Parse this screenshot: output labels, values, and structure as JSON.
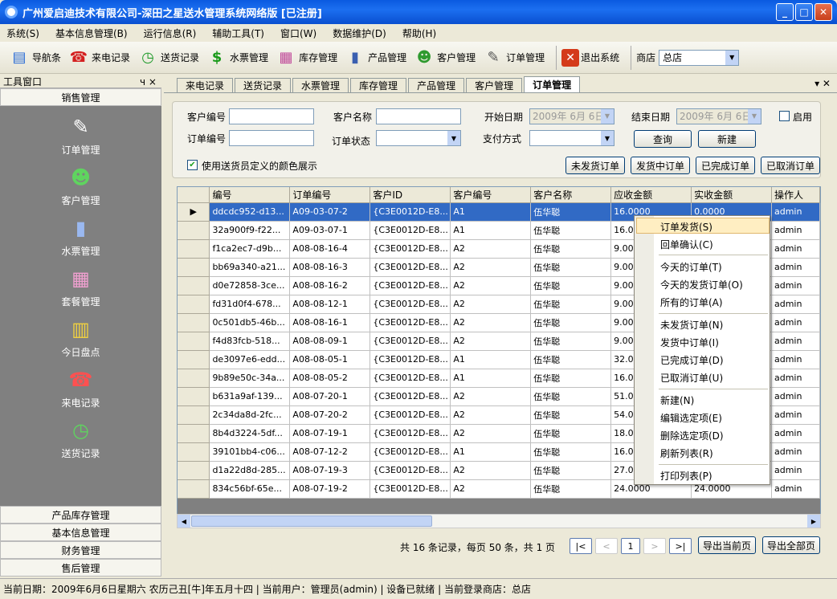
{
  "window": {
    "title": "广州爱启迪技术有限公司-深田之星送水管理系统网络版 [已注册]"
  },
  "menu": [
    "系统(S)",
    "基本信息管理(B)",
    "运行信息(R)",
    "辅助工具(T)",
    "窗口(W)",
    "数据维护(D)",
    "帮助(H)"
  ],
  "toolbar": {
    "items": [
      {
        "label": "导航条",
        "icon": "navigation-icon"
      },
      {
        "label": "来电记录",
        "icon": "phone-icon"
      },
      {
        "label": "送货记录",
        "icon": "clock-icon"
      },
      {
        "label": "水票管理",
        "icon": "dollar-icon"
      },
      {
        "label": "库存管理",
        "icon": "inventory-icon"
      },
      {
        "label": "产品管理",
        "icon": "product-icon"
      },
      {
        "label": "客户管理",
        "icon": "customers-icon"
      },
      {
        "label": "订单管理",
        "icon": "order-icon"
      },
      {
        "label": "退出系统",
        "icon": "exit-icon"
      }
    ],
    "shop_label": "商店",
    "shop_value": "总店"
  },
  "left": {
    "header": "工具窗口",
    "pin": "ч ×",
    "group_top": "销售管理",
    "items": [
      "订单管理",
      "客户管理",
      "水票管理",
      "套餐管理",
      "今日盘点",
      "来电记录",
      "送货记录"
    ],
    "groups_bottom": [
      "产品库存管理",
      "基本信息管理",
      "财务管理",
      "售后管理"
    ]
  },
  "tabs": [
    "来电记录",
    "送货记录",
    "水票管理",
    "库存管理",
    "产品管理",
    "客户管理",
    "订单管理"
  ],
  "filter": {
    "cust_no": "客户编号",
    "cust_name": "客户名称",
    "start_date": "开始日期",
    "start_value": "2009年 6月 6日",
    "end_date": "结束日期",
    "end_value": "2009年 6月 6日",
    "enable": "启用",
    "order_no": "订单编号",
    "order_status": "订单状态",
    "pay_method": "支付方式",
    "query": "查询",
    "new": "新建",
    "use_color": "使用送货员定义的颜色展示",
    "btn_unsent": "未发货订单",
    "btn_sending": "发货中订单",
    "btn_done": "已完成订单",
    "btn_cancel": "已取消订单"
  },
  "grid": {
    "columns": [
      "编号",
      "订单编号",
      "客户ID",
      "客户编号",
      "客户名称",
      "应收金额",
      "实收金额",
      "操作人"
    ],
    "rows": [
      [
        "ddcdc952-d13...",
        "A09-03-07-2",
        "{C3E0012D-E8...",
        "A1",
        "伍华聪",
        "16.0000",
        "0.0000",
        "admin"
      ],
      [
        "32a900f9-f22...",
        "A09-03-07-1",
        "{C3E0012D-E8...",
        "A1",
        "伍华聪",
        "16.0",
        "",
        "admin"
      ],
      [
        "f1ca2ec7-d9b...",
        "A08-08-16-4",
        "{C3E0012D-E8...",
        "A2",
        "伍华聪",
        "9.00",
        "",
        "admin"
      ],
      [
        "bb69a340-a21...",
        "A08-08-16-3",
        "{C3E0012D-E8...",
        "A2",
        "伍华聪",
        "9.00",
        "",
        "admin"
      ],
      [
        "d0e72858-3ce...",
        "A08-08-16-2",
        "{C3E0012D-E8...",
        "A2",
        "伍华聪",
        "9.00",
        "",
        "admin"
      ],
      [
        "fd31d0f4-678...",
        "A08-08-12-1",
        "{C3E0012D-E8...",
        "A2",
        "伍华聪",
        "9.00",
        "",
        "admin"
      ],
      [
        "0c501db5-46b...",
        "A08-08-16-1",
        "{C3E0012D-E8...",
        "A2",
        "伍华聪",
        "9.00",
        "",
        "admin"
      ],
      [
        "f4d83fcb-518...",
        "A08-08-09-1",
        "{C3E0012D-E8...",
        "A2",
        "伍华聪",
        "9.00",
        "",
        "admin"
      ],
      [
        "de3097e6-edd...",
        "A08-08-05-1",
        "{C3E0012D-E8...",
        "A1",
        "伍华聪",
        "32.0",
        "",
        "admin"
      ],
      [
        "9b89e50c-34a...",
        "A08-08-05-2",
        "{C3E0012D-E8...",
        "A1",
        "伍华聪",
        "16.0",
        "",
        "admin"
      ],
      [
        "b631a9af-139...",
        "A08-07-20-1",
        "{C3E0012D-E8...",
        "A2",
        "伍华聪",
        "51.0",
        "",
        "admin"
      ],
      [
        "2c34da8d-2fc...",
        "A08-07-20-2",
        "{C3E0012D-E8...",
        "A2",
        "伍华聪",
        "54.0",
        "",
        "admin"
      ],
      [
        "8b4d3224-5df...",
        "A08-07-19-1",
        "{C3E0012D-E8...",
        "A2",
        "伍华聪",
        "18.0",
        "",
        "admin"
      ],
      [
        "39101bb4-c06...",
        "A08-07-12-2",
        "{C3E0012D-E8...",
        "A1",
        "伍华聪",
        "16.0",
        "",
        "admin"
      ],
      [
        "d1a22d8d-285...",
        "A08-07-19-3",
        "{C3E0012D-E8...",
        "A2",
        "伍华聪",
        "27.0",
        "",
        "admin"
      ],
      [
        "834c56bf-65e...",
        "A08-07-19-2",
        "{C3E0012D-E8...",
        "A2",
        "伍华聪",
        "24.0000",
        "24.0000",
        "admin"
      ]
    ]
  },
  "context_menu": [
    "订单发货(S)",
    "回单确认(C)",
    "今天的订单(T)",
    "今天的发货订单(O)",
    "所有的订单(A)",
    "未发货订单(N)",
    "发货中订单(I)",
    "已完成订单(D)",
    "已取消订单(U)",
    "新建(N)",
    "编辑选定项(E)",
    "删除选定项(D)",
    "刷新列表(R)",
    "打印列表(P)"
  ],
  "pager": {
    "info": "共 16 条记录，每页 50 条，共 1 页",
    "page": "1",
    "export_page": "导出当前页",
    "export_all": "导出全部页"
  },
  "status": "当前日期：2009年6月6日星期六 农历己丑[牛]年五月十四 | 当前用户：管理员(admin) | 设备已就绪 | 当前登录商店：总店"
}
